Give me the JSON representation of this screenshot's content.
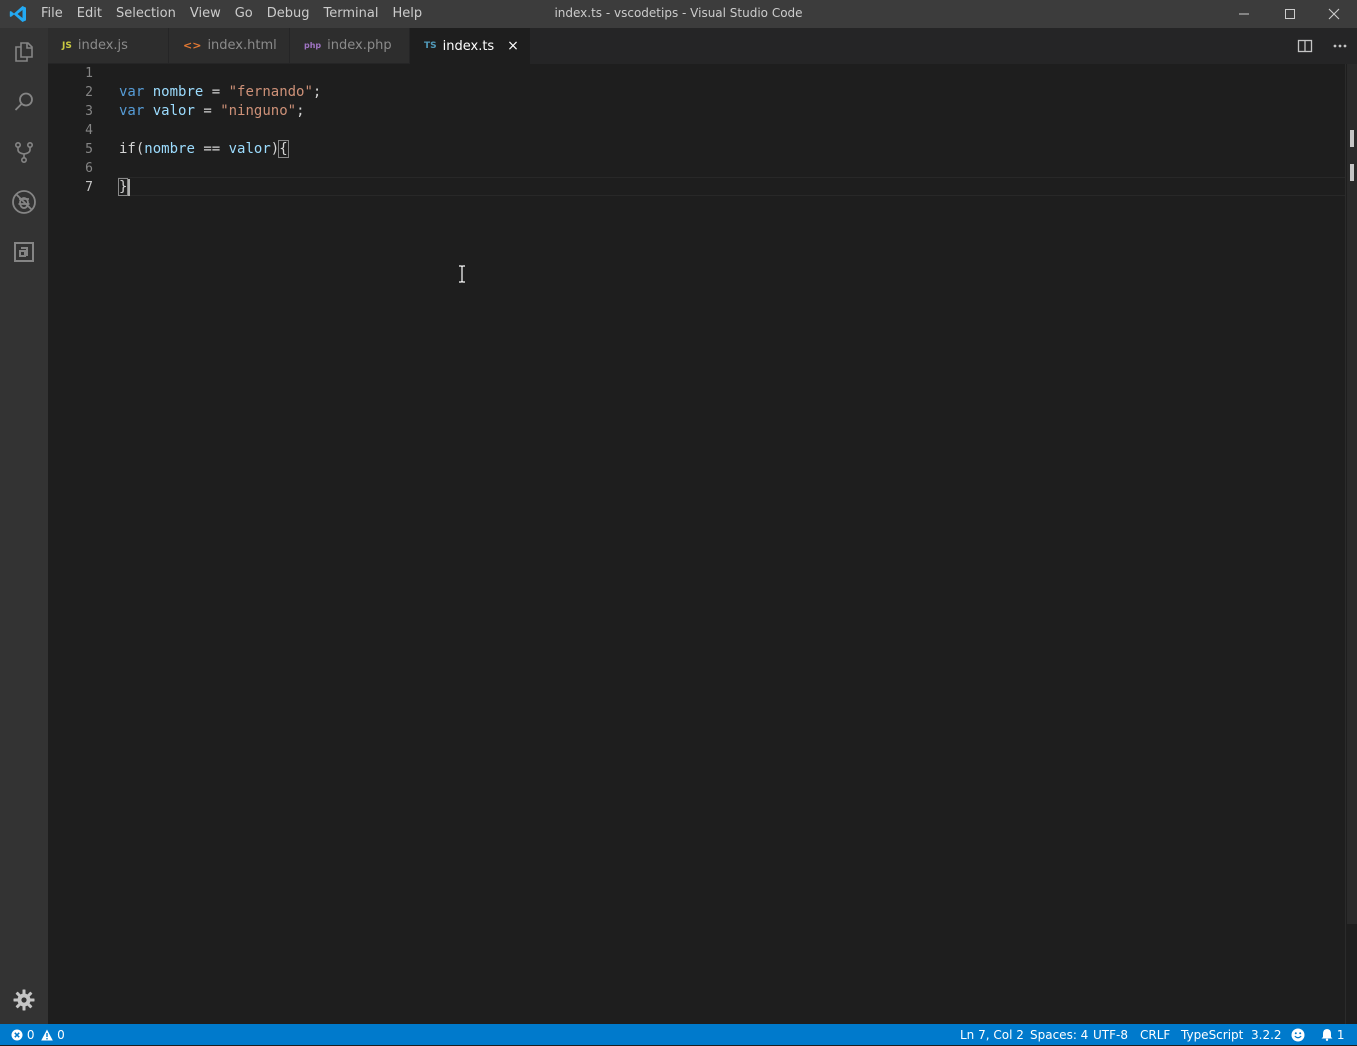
{
  "window": {
    "title": "index.ts - vscodetips - Visual Studio Code"
  },
  "menu": [
    "File",
    "Edit",
    "Selection",
    "View",
    "Go",
    "Debug",
    "Terminal",
    "Help"
  ],
  "tabs": [
    {
      "label": "index.js",
      "icon": "JS",
      "icon_color": "#cbcb41",
      "active": false
    },
    {
      "label": "index.html",
      "icon": "<>",
      "icon_color": "#e37933",
      "active": false
    },
    {
      "label": "index.php",
      "icon": "php",
      "icon_color": "#a074c4",
      "active": false
    },
    {
      "label": "index.ts",
      "icon": "TS",
      "icon_color": "#519aba",
      "active": true
    }
  ],
  "tab_close_glyph": "×",
  "editor": {
    "line_numbers": [
      "1",
      "2",
      "3",
      "4",
      "5",
      "6",
      "7"
    ],
    "code": {
      "l2": {
        "kw": "var",
        "name": "nombre",
        "eq": "=",
        "str": "\"fernando\"",
        "end": ";"
      },
      "l3": {
        "kw": "var",
        "name": "valor",
        "eq": "=",
        "str": "\"ninguno\"",
        "end": ";"
      },
      "l5": {
        "kw": "if",
        "open": "(",
        "a": "nombre",
        "op": "==",
        "b": "valor",
        "close": ")",
        "brace": "{"
      },
      "l7": {
        "brace": "}"
      }
    },
    "cursor_line": 7
  },
  "status": {
    "errors": "0",
    "warnings": "0",
    "position": "Ln 7, Col 2",
    "spaces": "Spaces: 4",
    "encoding": "UTF-8",
    "eol": "CRLF",
    "language": "TypeScript",
    "version": "3.2.2",
    "notifications": "1"
  },
  "colors": {
    "accent": "#007acc",
    "titlebar": "#3c3c3c",
    "activitybar": "#333333",
    "editor_bg": "#1e1e1e",
    "keyword": "#569cd6",
    "variable": "#9cdcfe",
    "string": "#ce9178"
  },
  "icons": {
    "activity": [
      "files-icon",
      "search-icon",
      "source-control-icon",
      "debug-icon",
      "extensions-icon"
    ],
    "manage": "gear-icon"
  }
}
